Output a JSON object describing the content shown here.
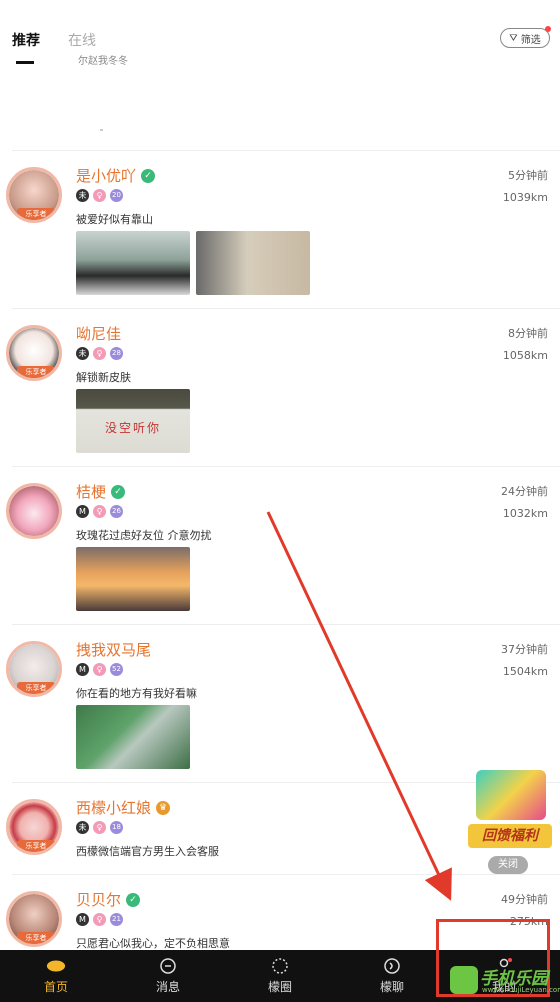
{
  "tabs": [
    "推荐",
    "在线"
  ],
  "filter_label": "筛选",
  "partial_text": "尔赵我冬冬",
  "feed": [
    {
      "name": "是小优吖",
      "verified": "green",
      "time": "5分钟前",
      "distance": "1039km",
      "tags": [
        "未",
        "",
        "20"
      ],
      "bio": "被爱好似有靠山",
      "photo_count": 2,
      "badge": "乐享者"
    },
    {
      "name": "呦尼佳",
      "verified": "",
      "time": "8分钟前",
      "distance": "1058km",
      "tags": [
        "未",
        "",
        "28"
      ],
      "bio": "解锁新皮肤",
      "photo_count": 1,
      "photo_caption": "没空听你",
      "badge": "乐享者"
    },
    {
      "name": "桔梗",
      "verified": "green",
      "time": "24分钟前",
      "distance": "1032km",
      "tags": [
        "M",
        "",
        "26"
      ],
      "bio": "玫瑰花过虑好友位 介意勿扰",
      "photo_count": 1,
      "badge": ""
    },
    {
      "name": "拽我双马尾",
      "verified": "",
      "time": "37分钟前",
      "distance": "1504km",
      "tags": [
        "M",
        "",
        "52"
      ],
      "bio": "你在看的地方有我好看嘛",
      "photo_count": 1,
      "badge": "乐享者"
    },
    {
      "name": "西檬小红娘",
      "verified": "orange",
      "time": "",
      "distance": "",
      "tags": [
        "未",
        "",
        "18"
      ],
      "bio": "西檬微信端官方男生入会客服",
      "photo_count": 0,
      "badge": "乐享者"
    },
    {
      "name": "贝贝尔",
      "verified": "green",
      "time": "49分钟前",
      "distance": "275km",
      "tags": [
        "M",
        "",
        "21"
      ],
      "bio": "只愿君心似我心，定不负相思意",
      "photo_count": 0,
      "badge": "乐享者"
    }
  ],
  "promo": {
    "label": "回馈福利",
    "close": "关闭"
  },
  "nav": [
    {
      "label": "首页",
      "icon": "lemon-icon"
    },
    {
      "label": "消息",
      "icon": "message-icon"
    },
    {
      "label": "檬圈",
      "icon": "circle-icon"
    },
    {
      "label": "檬聊",
      "icon": "chat-icon"
    },
    {
      "label": "我的",
      "icon": "profile-icon"
    }
  ],
  "watermark": {
    "text": "手机乐园",
    "sub": "www.shoujiLeyuan.com"
  }
}
